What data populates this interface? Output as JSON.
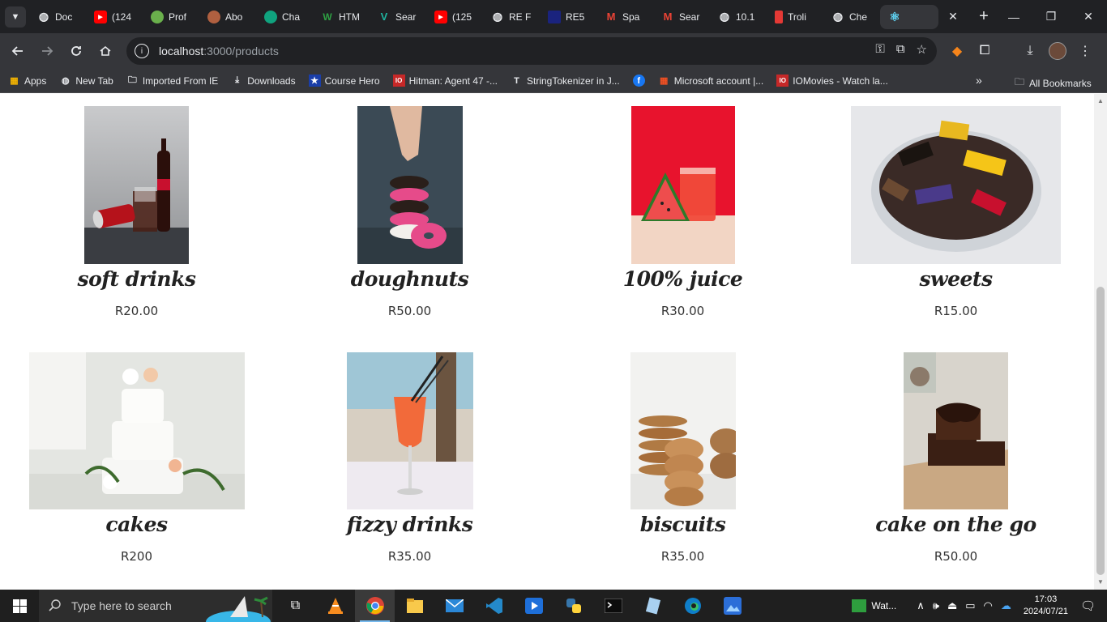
{
  "browser": {
    "tabs": [
      {
        "label": "Doc",
        "icon": "globe-icon",
        "color": "#9aa0a6"
      },
      {
        "label": "(124",
        "icon": "youtube-icon",
        "color": "#ff0000"
      },
      {
        "label": "Prof",
        "icon": "profile-icon",
        "color": "#6ab04c"
      },
      {
        "label": "Abo",
        "icon": "avatar-icon",
        "color": "#b06040"
      },
      {
        "label": "Cha",
        "icon": "chatgpt-icon",
        "color": "#ffffff"
      },
      {
        "label": "HTM",
        "icon": "w-icon",
        "color": "#2ea043"
      },
      {
        "label": "Sear",
        "icon": "vercel-v-icon",
        "color": "#1fb5a0"
      },
      {
        "label": "(125",
        "icon": "youtube-icon",
        "color": "#ff0000"
      },
      {
        "label": "RE F",
        "icon": "globe-icon",
        "color": "#9aa0a6"
      },
      {
        "label": "RE5",
        "icon": "re5-icon",
        "color": "#1a237e"
      },
      {
        "label": "Spa",
        "icon": "gmail-icon",
        "color": "#ea4335"
      },
      {
        "label": "Sear",
        "icon": "gmail-icon",
        "color": "#ea4335"
      },
      {
        "label": "10.1",
        "icon": "globe-icon",
        "color": "#9aa0a6"
      },
      {
        "label": "Troli",
        "icon": "troli-icon",
        "color": "#e53935"
      },
      {
        "label": "Che",
        "icon": "globe-icon",
        "color": "#9aa0a6"
      },
      {
        "label": "",
        "icon": "react-icon",
        "color": "#61dafb",
        "active": true
      }
    ],
    "url_host": "localhost",
    "url_path": ":3000/products",
    "bookmarks": [
      {
        "label": "Apps",
        "icon": "apps-grid-icon"
      },
      {
        "label": "New Tab",
        "icon": "globe-icon"
      },
      {
        "label": "Imported From IE",
        "icon": "folder-icon"
      },
      {
        "label": "Downloads",
        "icon": "download-icon"
      },
      {
        "label": "Course Hero",
        "icon": "star-icon"
      },
      {
        "label": "Hitman: Agent 47 -...",
        "icon": "io-icon"
      },
      {
        "label": "StringTokenizer in J...",
        "icon": "t-icon"
      },
      {
        "label": "",
        "icon": "facebook-icon"
      },
      {
        "label": "Microsoft account |...",
        "icon": "microsoft-icon"
      },
      {
        "label": "IOMovies - Watch la...",
        "icon": "io-icon"
      }
    ],
    "all_bookmarks": "All Bookmarks"
  },
  "products": [
    {
      "name": "soft drinks",
      "price": "R20.00"
    },
    {
      "name": "doughnuts",
      "price": "R50.00"
    },
    {
      "name": "100% juice",
      "price": "R30.00"
    },
    {
      "name": "sweets",
      "price": "R15.00"
    },
    {
      "name": "cakes",
      "price": "R200"
    },
    {
      "name": "fizzy drinks",
      "price": "R35.00"
    },
    {
      "name": "biscuits",
      "price": "R35.00"
    },
    {
      "name": "cake on the go",
      "price": "R50.00"
    }
  ],
  "taskbar": {
    "search_placeholder": "Type here to search",
    "tray_app": "Wat...",
    "time": "17:03",
    "date": "2024/07/21"
  }
}
